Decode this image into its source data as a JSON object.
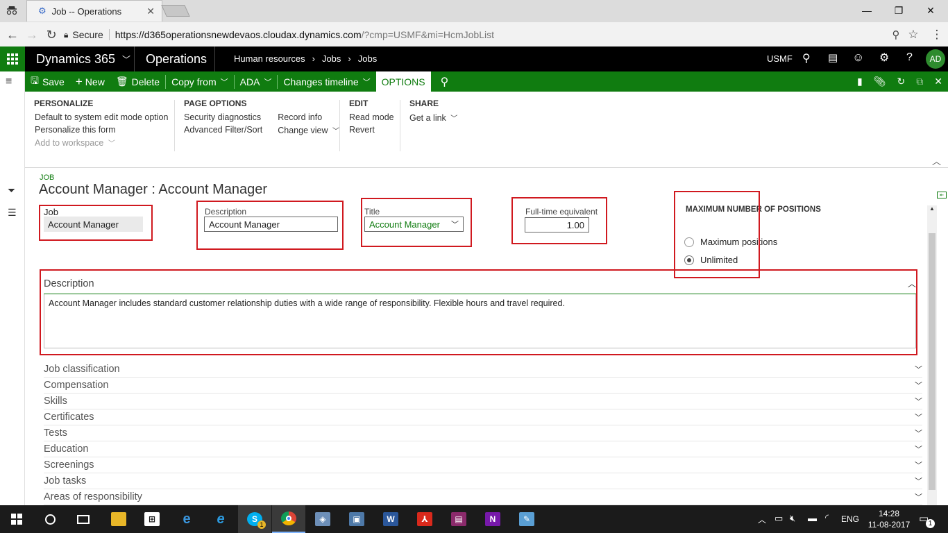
{
  "browser": {
    "tab_title": "Job -- Operations",
    "address_secure": "Secure",
    "url_host": "https://d365operationsnewdevaos.cloudax.dynamics.com",
    "url_rest": "/?cmp=USMF&mi=HcmJobList"
  },
  "app": {
    "product": "Dynamics 365",
    "module": "Operations",
    "breadcrumb": [
      "Human resources",
      "Jobs",
      "Jobs"
    ],
    "company": "USMF",
    "user_initials": "AD"
  },
  "actionbar": {
    "save": "Save",
    "new": "New",
    "delete": "Delete",
    "copy_from": "Copy from",
    "ada": "ADA",
    "changes_timeline": "Changes timeline",
    "options": "OPTIONS"
  },
  "options_pane": {
    "personalize": {
      "header": "PERSONALIZE",
      "items": [
        "Default to system edit mode option",
        "Personalize this form",
        "Add to workspace"
      ]
    },
    "page_options": {
      "header": "PAGE OPTIONS",
      "col1": [
        "Security diagnostics",
        "Advanced Filter/Sort"
      ],
      "col2": [
        "Record info",
        "Change view"
      ]
    },
    "edit": {
      "header": "EDIT",
      "items": [
        "Read mode",
        "Revert"
      ]
    },
    "share": {
      "header": "SHARE",
      "items": [
        "Get a link"
      ]
    }
  },
  "form": {
    "caption": "JOB",
    "title": "Account Manager : Account Manager",
    "job_label": "Job",
    "job_value": "Account Manager",
    "description_label": "Description",
    "description_value": "Account Manager",
    "title_label": "Title",
    "title_value": "Account Manager",
    "fte_label": "Full-time equivalent",
    "fte_value": "1.00",
    "max_positions_header": "MAXIMUM NUMBER OF POSITIONS",
    "radio_max": "Maximum positions",
    "radio_unlimited": "Unlimited",
    "radio_selected": "Unlimited",
    "desc_section_title": "Description",
    "desc_text": "Account Manager includes standard customer relationship duties with a wide range of  responsibility. Flexible hours and travel required.",
    "fasttabs": [
      "Job classification",
      "Compensation",
      "Skills",
      "Certificates",
      "Tests",
      "Education",
      "Screenings",
      "Job tasks",
      "Areas of responsibility"
    ]
  },
  "taskbar": {
    "language": "ENG",
    "time": "14:28",
    "date": "11-08-2017",
    "notification_count": "1",
    "skype_badge": "1"
  },
  "colors": {
    "d365_green": "#107c10",
    "highlight_red": "#d0191f",
    "nav_black": "#000000"
  }
}
